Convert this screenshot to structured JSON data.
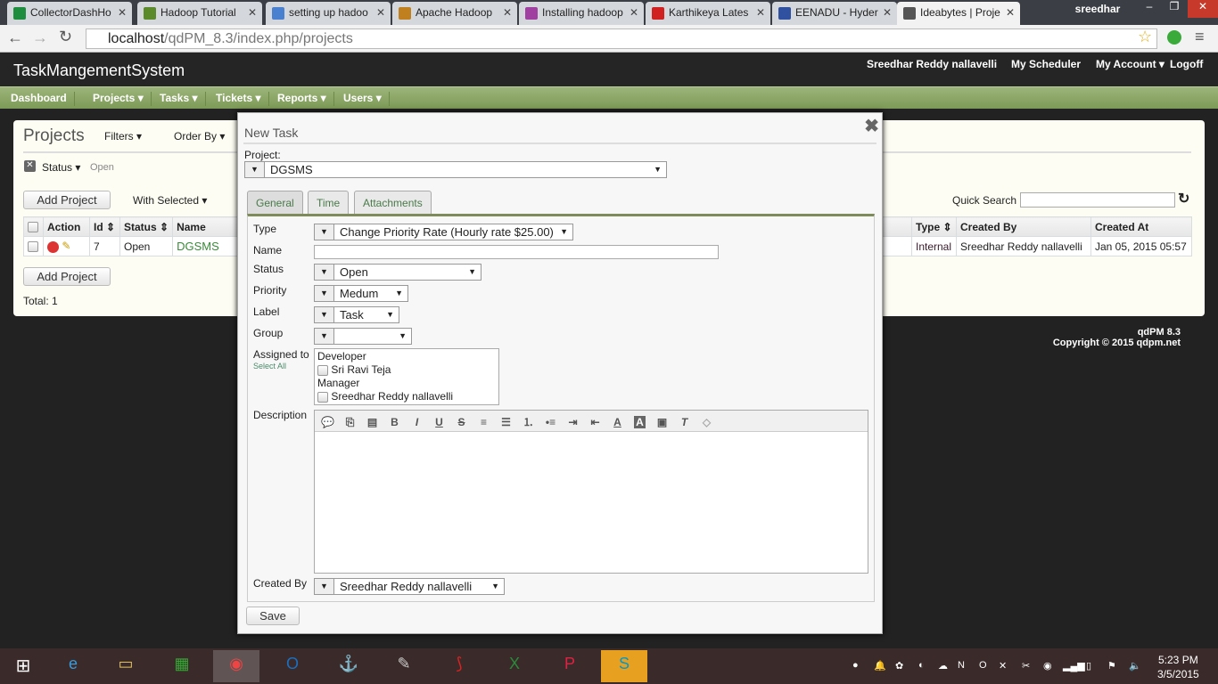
{
  "browser": {
    "tabs": [
      {
        "title": "CollectorDashHo",
        "color": "#1e8e3e"
      },
      {
        "title": "Hadoop Tutorial",
        "color": "#5a8a2a"
      },
      {
        "title": "setting up hadoo",
        "color": "#4a80d0"
      },
      {
        "title": "Apache Hadoop",
        "color": "#c08020"
      },
      {
        "title": "Installing hadoop",
        "color": "#a040a0"
      },
      {
        "title": "Karthikeya Lates",
        "color": "#d02020"
      },
      {
        "title": "EENADU - Hyder",
        "color": "#3050a0"
      },
      {
        "title": "Ideabytes | Proje",
        "color": "#555555"
      }
    ],
    "user": "sreedhar",
    "url_host": "localhost",
    "url_path": "/qdPM_8.3/index.php/projects"
  },
  "app": {
    "title": "TaskMangementSystem",
    "top_links": [
      "Sreedhar Reddy nallavelli",
      "My Scheduler",
      "My Account",
      "Logoff"
    ],
    "nav": [
      "Dashboard",
      "Projects",
      "Tasks",
      "Tickets",
      "Reports",
      "Users"
    ]
  },
  "projects": {
    "heading": "Projects",
    "filters": "Filters",
    "order_by": "Order By",
    "filter_label": "Status",
    "filter_value": "Open",
    "add_project": "Add Project",
    "with_selected": "With Selected",
    "quick_search": "Quick Search",
    "columns": [
      "Action",
      "Id",
      "Status",
      "Name",
      "Type",
      "Created By",
      "Created At"
    ],
    "rows": [
      {
        "id": "7",
        "status": "Open",
        "name": "DGSMS",
        "type": "Internal",
        "created_by": "Sreedhar Reddy nallavelli",
        "created_at": "Jan 05, 2015 05:57"
      }
    ],
    "total": "Total: 1"
  },
  "footer": {
    "version": "qdPM 8.3",
    "copyright": "Copyright © 2015 qdpm.net"
  },
  "modal": {
    "title": "New Task",
    "project_label": "Project:",
    "project": "DGSMS",
    "tabs": [
      "General",
      "Time",
      "Attachments"
    ],
    "type_label": "Type",
    "type": "Change Priority Rate (Hourly rate $25.00)",
    "name_label": "Name",
    "name": "",
    "status_label": "Status",
    "status": "Open",
    "priority_label": "Priority",
    "priority": "Medum",
    "label_label": "Label",
    "label": "Task",
    "group_label": "Group",
    "group": "",
    "assigned_label": "Assigned to",
    "select_all": "Select All",
    "assignees": [
      {
        "group": "Developer",
        "user": "Sri Ravi Teja"
      },
      {
        "group": "Manager",
        "user": "Sreedhar Reddy nallavelli"
      }
    ],
    "description_label": "Description",
    "toolbar": [
      "comment",
      "source",
      "template",
      "B",
      "I",
      "U",
      "S",
      "align-left",
      "hr",
      "ol",
      "ul",
      "indent",
      "outdent",
      "text-color",
      "bg-color",
      "image",
      "remove-format",
      "code"
    ],
    "created_by_label": "Created By",
    "created_by": "Sreedhar Reddy nallavelli",
    "save": "Save"
  },
  "taskbar": {
    "time": "5:23 PM",
    "date": "3/5/2015"
  }
}
